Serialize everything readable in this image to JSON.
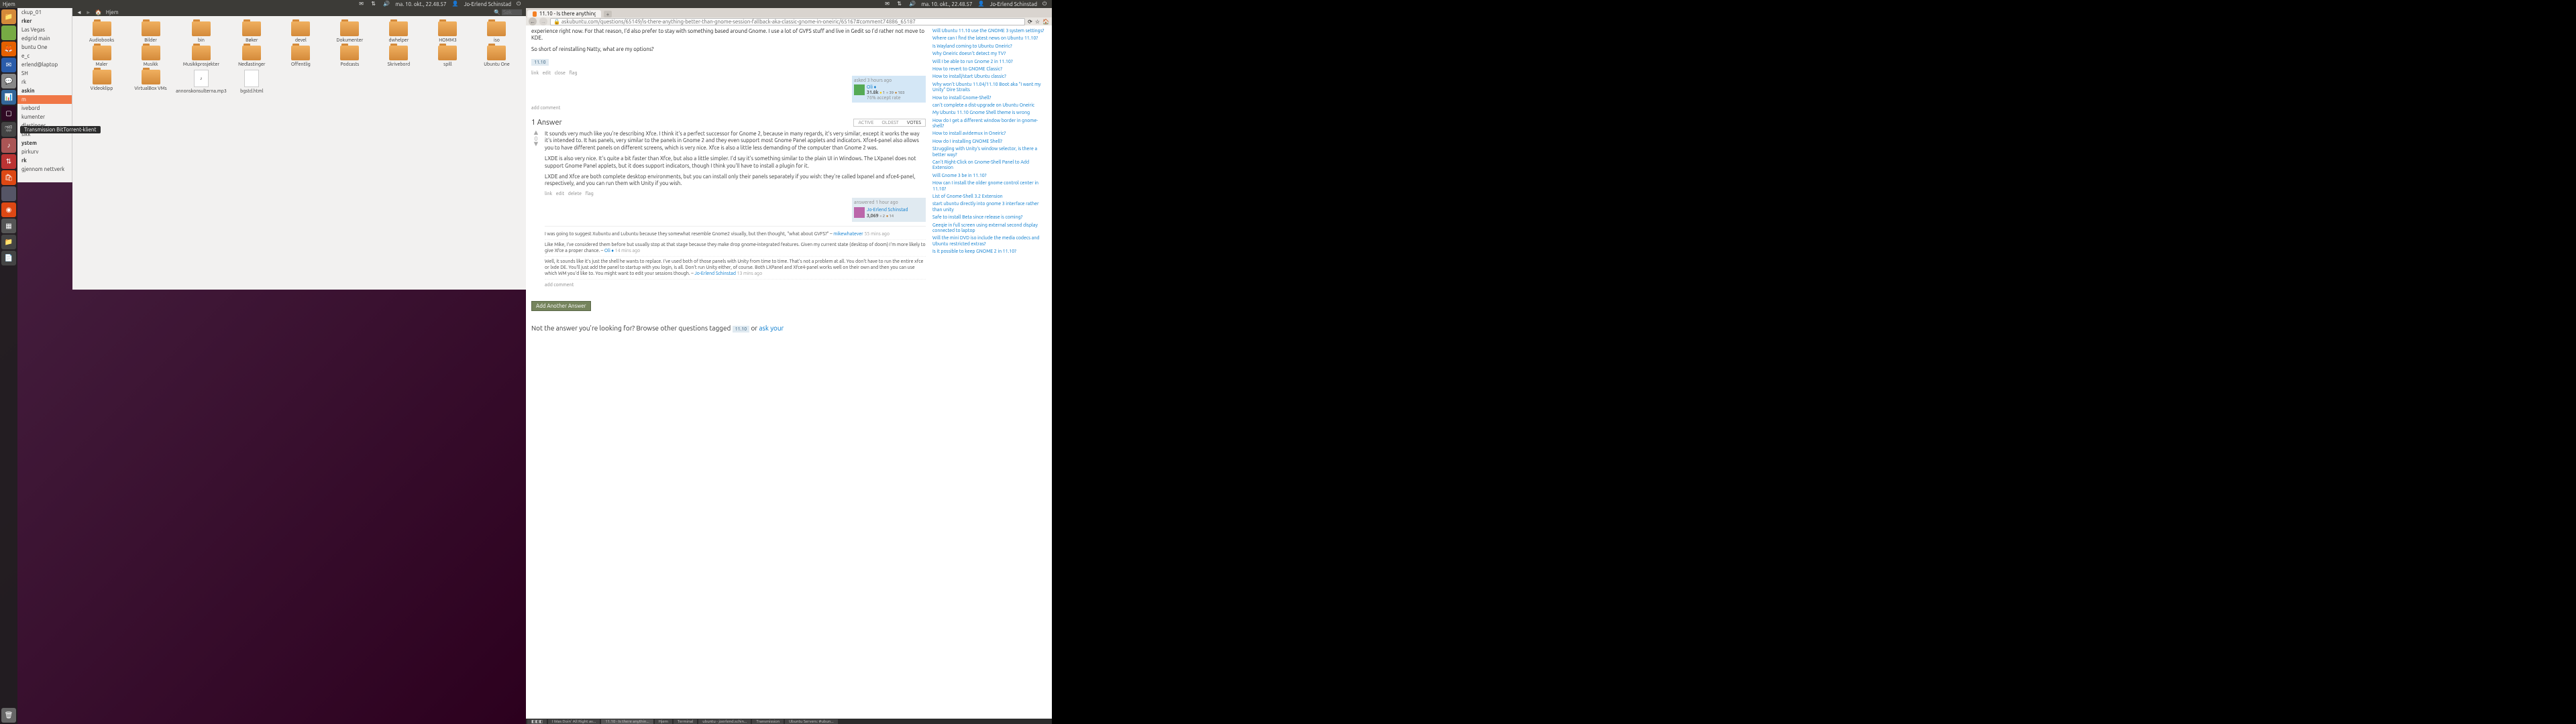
{
  "panel": {
    "clock": "ma. 10. okt., 22.48.57",
    "user": "Jo-Erlend Schinstad"
  },
  "nautilus": {
    "title": "Hjem",
    "location": "Hjem",
    "search_placeholder": "Søk",
    "folders_row1": [
      "Audiobooks",
      "Bilder",
      "bin",
      "Bøker",
      "devel",
      "Dokumenter",
      "dwhelper",
      "HOMM3",
      "iso"
    ],
    "folders_row1b": [
      "Maler"
    ],
    "folders_row2": [
      "Musikk",
      "Musikkprosjekter",
      "Nedlastinger",
      "Offentlig",
      "Podcasts",
      "Skrivebord",
      "spill",
      "Ubuntu One",
      "Videoklipp"
    ],
    "folders_row2b": [
      "VirtualBox VMs"
    ],
    "files": [
      "annonskonsulterna.mp3",
      "bgstd.html"
    ]
  },
  "places": {
    "items": [
      "ckup_01",
      "rker",
      "Las Vegas",
      "edgrid main",
      "buntu One",
      "e_c",
      "erlend@laptop",
      "SH",
      "rk",
      "askin",
      "m",
      "ivebord",
      "kumenter",
      "dlastinger",
      "sikk",
      "ystem",
      "pirkurv",
      "rk",
      "gjennom nettverk"
    ],
    "selected_index": 10
  },
  "tooltip": "Transmission BitTorrent-klient",
  "firefox": {
    "tab_title": "11.10 - Is there anything better...",
    "url": "askubuntu.com/questions/65149/is-there-anything-better-than-gnome-session-fallback-aka-classic-gnome-in-oneiric/65167#comment74886_65187",
    "question": {
      "body_fragment": "experience right now. For that reason, I'd also prefer to stay with something based around Gnome. I use a lot of GVFS stuff and live in Gedit so I'd rather not move to KDE.",
      "body_line2": "So short of reinstalling Natty, what are my options?",
      "tag": "11.10",
      "menu": [
        "link",
        "edit",
        "close",
        "flag"
      ],
      "asked": "asked 3 hours ago",
      "asker": "Oli ♦",
      "asker_rep": "31.8k",
      "asker_gold": "1",
      "asker_silver": "39",
      "asker_bronze": "103",
      "accept_rate": "76% accept rate",
      "add_comment": "add comment"
    },
    "answers_header": "1 Answer",
    "answer_tabs": [
      "ACTIVE",
      "OLDEST",
      "VOTES"
    ],
    "answer": {
      "votes": "0",
      "p1": "It sounds very much like you're describing Xfce. I think it's a perfect successor for Gnome 2, because in many regards, it's very similar, except it works the way it's intended to. It has panels, very similar to the panels in Gnome 2 and they even support most Gnome Panel applets and indicators. Xfce4-panel also allows you to have different panels on different screens, which is very nice. Xfce is also a little less demanding of the computer than Gnome 2 was.",
      "p2": "LXDE is also very nice. It's quite a bit faster than Xfce, but also a little simpler. I'd say it's something similar to the plain UI in Windows. The LXpanel does not support Gnome Panel applets, but it does support indicators, though I think you'll have to install a plugin for it.",
      "p3": "LXDE and Xfce are both complete desktop environments, but you can install only their panels separately if you wish: they're called lxpanel and xfce4-panel, respectively, and you can run them with Unity if you wish.",
      "menu": [
        "link",
        "edit",
        "delete",
        "flag"
      ],
      "answered": "answered 1 hour ago",
      "answerer": "Jo-Erlend Schinstad",
      "answerer_rep": "3,069",
      "answerer_silver": "2",
      "answerer_bronze": "14"
    },
    "comments": [
      {
        "text": "I was going to suggest Xubuntu and Lubuntu because they somewhat resemble Gnome2 visually, but then thought, \"what about GVFS?\" –",
        "author": "mikewhatever",
        "time": "55 mins ago"
      },
      {
        "text": "Like Mike, I've considered them before but usually stop at that stage because they make drop gnome-integrated features. Given my current state (desktop of doom) I'm more likely to give Xfce a proper chance. –",
        "author": "Oli ♦",
        "time": "14 mins ago"
      },
      {
        "text": "Well, it sounds like it's just the shell he wants to replace. I've used both of those panels with Unity from time to time. That's not a problem at all. You don't have to run the entire xfce or lxde DE. You'll just add the panel to startup with you login, is all. Don't run Unity either, of course. Both LXPanel and Xfce4-panel works well on their own and then you can use which WM you'd like to. You might want to edit your sessions though. –",
        "author": "Jo-Erlend Schinstad",
        "time": "13 mins ago"
      }
    ],
    "add_comment2": "add comment",
    "add_answer_btn": "Add Another Answer",
    "bottom_prompt_pre": "Not the answer you're looking for? Browse other questions tagged",
    "bottom_prompt_tag": "11.10",
    "bottom_prompt_or": "or",
    "bottom_prompt_link": "ask your",
    "related_heading": "",
    "related": [
      "Will Ubuntu 11.10 use the GNOME 3 system settings?",
      "Where can I find the latest news on Ubuntu 11.10?",
      "Is Wayland coming to Ubuntu Oneiric?",
      "Why Oneiric doesn't detect my TV?",
      "Will I be able to run Gnome 2 in 11.10?",
      "How to revert to GNOME Classic?",
      "How to install/start Ubuntu classic?",
      "Why won't Ubuntu 11.04/11.10 Boot aka \"I want my Unity\" Dire Straits",
      "How to install Gnome-Shell?",
      "can't complete a dist-upgrade on Ubuntu Oneiric",
      "My Ubuntu 11.10 Gnome Shell theme is wrong",
      "How do I get a different window border in gnome-shell?",
      "How to install avidemux in Oneiric?",
      "How do I installing GNOME Shell?",
      "Struggling with Unity's window selector, is there a better way?",
      "Can't Right-Click on Gnome-Shell Panel to Add Extension",
      "Will Gnome 3 be in 11.10?",
      "How can I install the older gnome control center in 11.10?",
      "List of Gnome-Shell 3.2 Extension",
      "start ubuntu directly into gnome 3 interface rather than unity",
      "Safe to install Beta since release is coming?",
      "Geeqie in full screen using external second display connected to laptop",
      "Will the mini DVD iso include the media codecs and Ubuntu restricted extras?",
      "Is it possible to keep GNOME 2 in 11.10?"
    ]
  },
  "taskbar": {
    "items": [
      "I Was Doin' All Right av...",
      "11.10 - Is there anythin...",
      "Hjem",
      "Terminal",
      "ubuntu - joerlend.schin...",
      "Transmission",
      "Ubuntu Servers: #ubun..."
    ]
  }
}
